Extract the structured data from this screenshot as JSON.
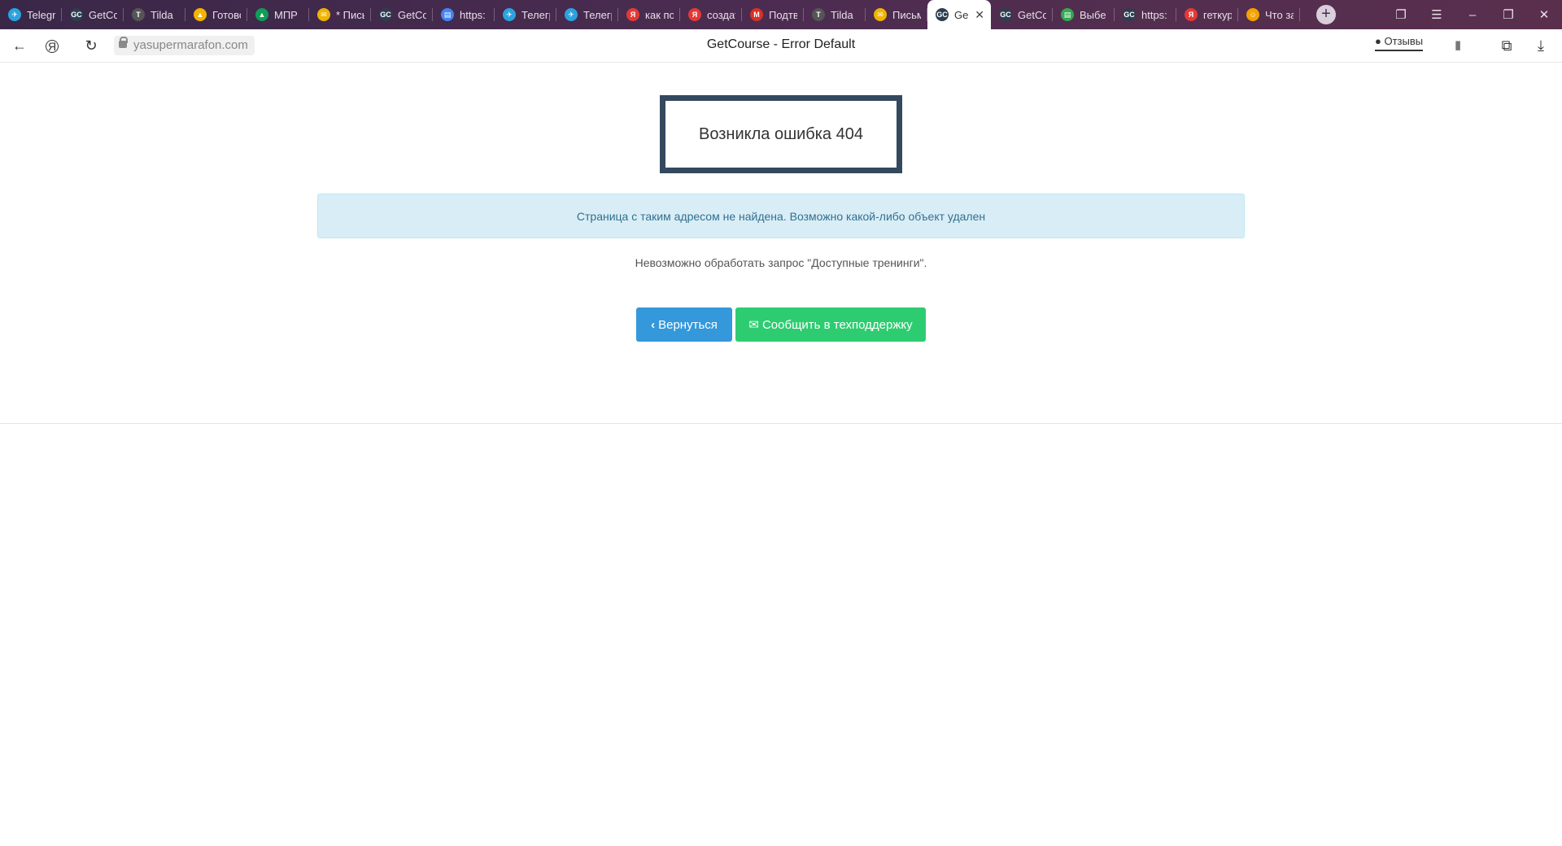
{
  "browser": {
    "tabs": [
      {
        "title": "Telegram",
        "icon": "telegram-icon",
        "color": "#2aa3e0"
      },
      {
        "title": "GetCourse",
        "icon": "getcourse-icon",
        "color": "#2c3e50"
      },
      {
        "title": "Tilda",
        "icon": "tilda-icon",
        "color": "#555555"
      },
      {
        "title": "Готово",
        "icon": "drive-icon",
        "color": "#f4b400"
      },
      {
        "title": "МПР",
        "icon": "drive-icon",
        "color": "#0f9d58"
      },
      {
        "title": "* Письма",
        "icon": "mail-icon",
        "color": "#f0b400"
      },
      {
        "title": "GetCourse",
        "icon": "getcourse-icon",
        "color": "#2c3e50"
      },
      {
        "title": "https:",
        "icon": "doc-icon",
        "color": "#4285f4"
      },
      {
        "title": "Телеграм",
        "icon": "telegram-icon",
        "color": "#2aa3e0"
      },
      {
        "title": "Телеграм",
        "icon": "telegram-icon",
        "color": "#2aa3e0"
      },
      {
        "title": "как по",
        "icon": "yandex-icon",
        "color": "#e53935"
      },
      {
        "title": "создать",
        "icon": "yandex-icon",
        "color": "#e53935"
      },
      {
        "title": "Подтв",
        "icon": "gmail-icon",
        "color": "#d93025"
      },
      {
        "title": "Tilda",
        "icon": "tilda-icon",
        "color": "#555555"
      },
      {
        "title": "Письм",
        "icon": "mail-icon",
        "color": "#f0b400"
      },
      {
        "title": "Ge",
        "icon": "getcourse-icon",
        "color": "#2c3e50",
        "active": true
      },
      {
        "title": "GetCo",
        "icon": "getcourse-icon",
        "color": "#2c3e50"
      },
      {
        "title": "Выбе",
        "icon": "doc-icon",
        "color": "#34a853"
      },
      {
        "title": "https:",
        "icon": "getcourse-icon",
        "color": "#2c3e50"
      },
      {
        "title": "геткур",
        "icon": "yandex-icon",
        "color": "#e53935"
      },
      {
        "title": "Что за",
        "icon": "smile-icon",
        "color": "#f4a300"
      }
    ],
    "url": "yasupermarafon.com",
    "page_title": "GetCourse - Error Default",
    "reviews_label": "Отзывы"
  },
  "page": {
    "error_title": "Возникла ошибка 404",
    "alert_text": "Страница с таким адресом не найдена. Возможно какой-либо объект удален",
    "subtext": "Невозможно обработать запрос \"Доступные тренинги\".",
    "back_label": "Вернуться",
    "support_label": "Сообщить в техподдержку"
  },
  "colors": {
    "back_button": "#3498db",
    "support_button": "#2ecc71",
    "error_border": "#34495e",
    "alert_bg": "#d9edf7"
  }
}
